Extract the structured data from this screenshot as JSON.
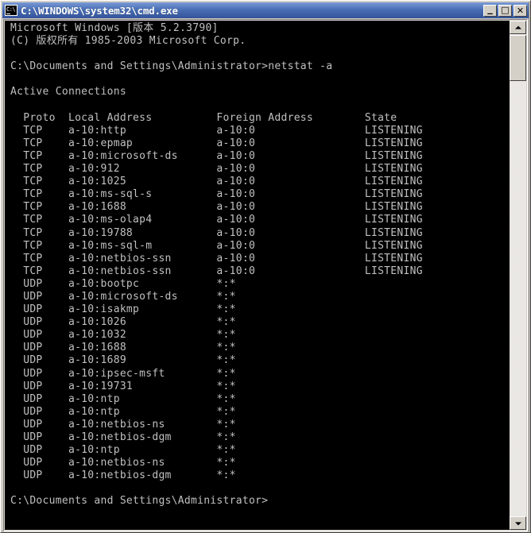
{
  "window": {
    "title": "C:\\WINDOWS\\system32\\cmd.exe",
    "icon": "cmd-console-icon",
    "titlebar_color": "#3d5fa5",
    "console_bg": "#000000",
    "console_fg": "#c0c0c0",
    "controls": {
      "minimize_label": "_",
      "maximize_label": "□",
      "close_label": "✕"
    },
    "scrollbar": {
      "up_arrow": "▲",
      "down_arrow": "▼",
      "thumb_position": "top"
    }
  },
  "console": {
    "banner": [
      "Microsoft Windows [版本 5.2.3790]",
      "(C) 版权所有 1985-2003 Microsoft Corp."
    ],
    "prompt": "C:\\Documents and Settings\\Administrator>",
    "command": "netstat -a",
    "section_title": "Active Connections",
    "columns": [
      "Proto",
      "Local Address",
      "Foreign Address",
      "State"
    ],
    "rows": [
      {
        "proto": "TCP",
        "local": "a-10:http",
        "foreign": "a-10:0",
        "state": "LISTENING"
      },
      {
        "proto": "TCP",
        "local": "a-10:epmap",
        "foreign": "a-10:0",
        "state": "LISTENING"
      },
      {
        "proto": "TCP",
        "local": "a-10:microsoft-ds",
        "foreign": "a-10:0",
        "state": "LISTENING"
      },
      {
        "proto": "TCP",
        "local": "a-10:912",
        "foreign": "a-10:0",
        "state": "LISTENING"
      },
      {
        "proto": "TCP",
        "local": "a-10:1025",
        "foreign": "a-10:0",
        "state": "LISTENING"
      },
      {
        "proto": "TCP",
        "local": "a-10:ms-sql-s",
        "foreign": "a-10:0",
        "state": "LISTENING"
      },
      {
        "proto": "TCP",
        "local": "a-10:1688",
        "foreign": "a-10:0",
        "state": "LISTENING"
      },
      {
        "proto": "TCP",
        "local": "a-10:ms-olap4",
        "foreign": "a-10:0",
        "state": "LISTENING"
      },
      {
        "proto": "TCP",
        "local": "a-10:19788",
        "foreign": "a-10:0",
        "state": "LISTENING"
      },
      {
        "proto": "TCP",
        "local": "a-10:ms-sql-m",
        "foreign": "a-10:0",
        "state": "LISTENING"
      },
      {
        "proto": "TCP",
        "local": "a-10:netbios-ssn",
        "foreign": "a-10:0",
        "state": "LISTENING"
      },
      {
        "proto": "TCP",
        "local": "a-10:netbios-ssn",
        "foreign": "a-10:0",
        "state": "LISTENING"
      },
      {
        "proto": "UDP",
        "local": "a-10:bootpc",
        "foreign": "*:*",
        "state": ""
      },
      {
        "proto": "UDP",
        "local": "a-10:microsoft-ds",
        "foreign": "*:*",
        "state": ""
      },
      {
        "proto": "UDP",
        "local": "a-10:isakmp",
        "foreign": "*:*",
        "state": ""
      },
      {
        "proto": "UDP",
        "local": "a-10:1026",
        "foreign": "*:*",
        "state": ""
      },
      {
        "proto": "UDP",
        "local": "a-10:1032",
        "foreign": "*:*",
        "state": ""
      },
      {
        "proto": "UDP",
        "local": "a-10:1688",
        "foreign": "*:*",
        "state": ""
      },
      {
        "proto": "UDP",
        "local": "a-10:1689",
        "foreign": "*:*",
        "state": ""
      },
      {
        "proto": "UDP",
        "local": "a-10:ipsec-msft",
        "foreign": "*:*",
        "state": ""
      },
      {
        "proto": "UDP",
        "local": "a-10:19731",
        "foreign": "*:*",
        "state": ""
      },
      {
        "proto": "UDP",
        "local": "a-10:ntp",
        "foreign": "*:*",
        "state": ""
      },
      {
        "proto": "UDP",
        "local": "a-10:ntp",
        "foreign": "*:*",
        "state": ""
      },
      {
        "proto": "UDP",
        "local": "a-10:netbios-ns",
        "foreign": "*:*",
        "state": ""
      },
      {
        "proto": "UDP",
        "local": "a-10:netbios-dgm",
        "foreign": "*:*",
        "state": ""
      },
      {
        "proto": "UDP",
        "local": "a-10:ntp",
        "foreign": "*:*",
        "state": ""
      },
      {
        "proto": "UDP",
        "local": "a-10:netbios-ns",
        "foreign": "*:*",
        "state": ""
      },
      {
        "proto": "UDP",
        "local": "a-10:netbios-dgm",
        "foreign": "*:*",
        "state": ""
      }
    ],
    "column_offsets": {
      "proto": 2,
      "local": 9,
      "foreign": 32,
      "state": 55
    }
  }
}
